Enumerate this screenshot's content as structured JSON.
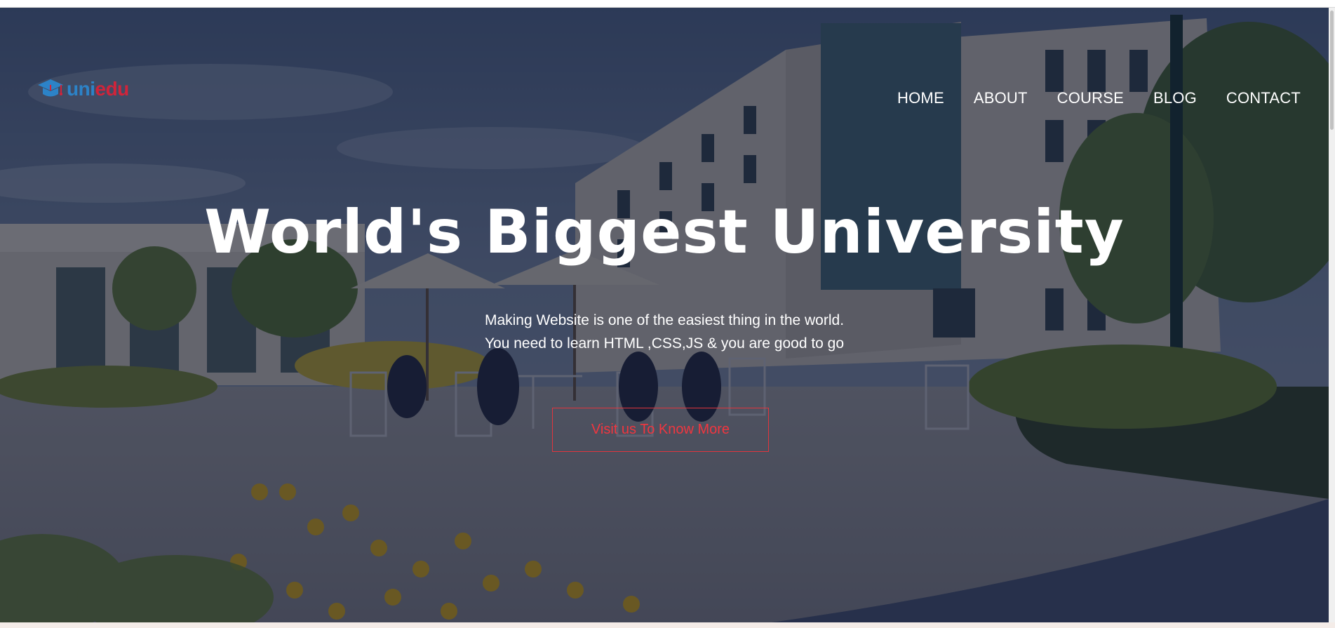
{
  "brand": {
    "logo_part1": "uni",
    "logo_part2": "edu",
    "primary_color": "#2c83c8",
    "accent_color": "#d0243a",
    "logo_icon": "graduation-cap-icon"
  },
  "nav": {
    "items": [
      {
        "label": "HOME"
      },
      {
        "label": "ABOUT"
      },
      {
        "label": "COURSE"
      },
      {
        "label": "BLOG"
      },
      {
        "label": "CONTACT"
      }
    ]
  },
  "hero": {
    "title": "World's Biggest University",
    "subtitle_line1": "Making Website is one of the easiest thing in the world.",
    "subtitle_line2": "You need to learn HTML ,CSS,JS & you are good to go",
    "cta_label": "Visit us To Know More",
    "cta_color": "#f0363f",
    "background": "university campus courtyard photo with dark overlay"
  }
}
